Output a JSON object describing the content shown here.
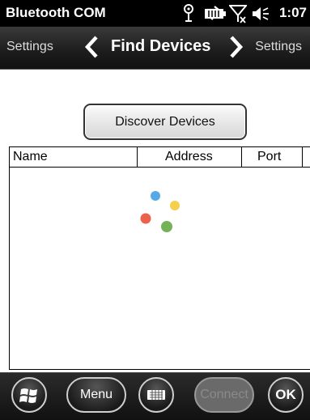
{
  "status": {
    "app_title": "Bluetooth COM",
    "time": "1:07",
    "icons": [
      "bluetooth-icon",
      "data-sync-icon",
      "signal-off-icon",
      "volume-icon",
      "battery-icon"
    ]
  },
  "navbar": {
    "prev_label": "Settings",
    "title": "Find Devices",
    "next_label": "Settings"
  },
  "discover": {
    "label": "Discover Devices"
  },
  "device_list": {
    "columns": [
      "Name",
      "Address",
      "Port"
    ],
    "rows": [],
    "loading": true,
    "spinner_colors": [
      "#3a9be0",
      "#f2c82e",
      "#e8452c",
      "#5aa43a"
    ]
  },
  "bottombar": {
    "start_icon": "windows-flag-icon",
    "menu_label": "Menu",
    "keyboard_icon": "keyboard-icon",
    "connect_label": "Connect",
    "connect_enabled": false,
    "ok_label": "OK"
  }
}
